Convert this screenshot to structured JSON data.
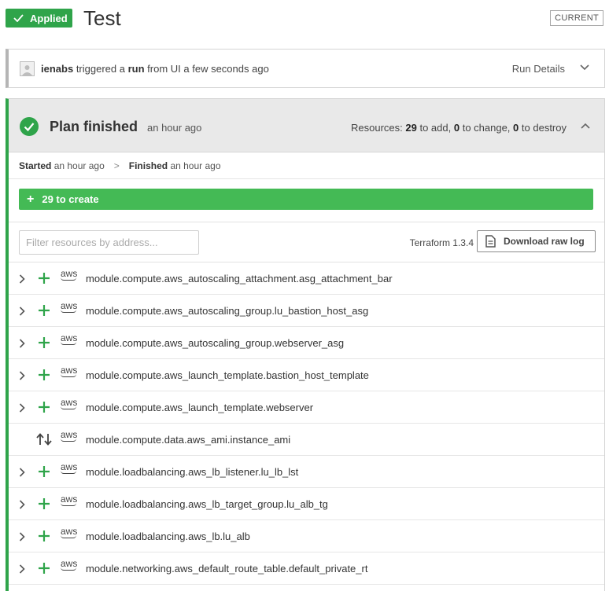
{
  "header": {
    "status_badge": "Applied",
    "title": "Test",
    "current_badge": "CURRENT"
  },
  "run": {
    "user": "ienabs",
    "text_triggered": "triggered a",
    "text_run": "run",
    "text_rest": "from UI a few seconds ago",
    "details_label": "Run Details"
  },
  "plan": {
    "title": "Plan finished",
    "time": "an hour ago",
    "resources_label": "Resources:",
    "add_count": "29",
    "add_label": "to add,",
    "change_count": "0",
    "change_label": "to change,",
    "destroy_count": "0",
    "destroy_label": "to destroy",
    "started_label": "Started",
    "started_time": "an hour ago",
    "finished_label": "Finished",
    "finished_time": "an hour ago",
    "create_bar_label": "29 to create",
    "filter_placeholder": "Filter resources by address...",
    "terraform_version": "Terraform 1.3.4",
    "download_label": "Download raw log",
    "resources": [
      {
        "action": "create",
        "address": "module.compute.aws_autoscaling_attachment.asg_attachment_bar"
      },
      {
        "action": "create",
        "address": "module.compute.aws_autoscaling_group.lu_bastion_host_asg"
      },
      {
        "action": "create",
        "address": "module.compute.aws_autoscaling_group.webserver_asg"
      },
      {
        "action": "create",
        "address": "module.compute.aws_launch_template.bastion_host_template"
      },
      {
        "action": "create",
        "address": "module.compute.aws_launch_template.webserver"
      },
      {
        "action": "read",
        "address": "module.compute.data.aws_ami.instance_ami"
      },
      {
        "action": "create",
        "address": "module.loadbalancing.aws_lb_listener.lu_lb_lst"
      },
      {
        "action": "create",
        "address": "module.loadbalancing.aws_lb_target_group.lu_alb_tg"
      },
      {
        "action": "create",
        "address": "module.loadbalancing.aws_lb.lu_alb"
      },
      {
        "action": "create",
        "address": "module.networking.aws_default_route_table.default_private_rt"
      }
    ],
    "provider_label": "aws"
  },
  "colors": {
    "success": "#2fa44a",
    "create_bar": "#44ba55"
  }
}
